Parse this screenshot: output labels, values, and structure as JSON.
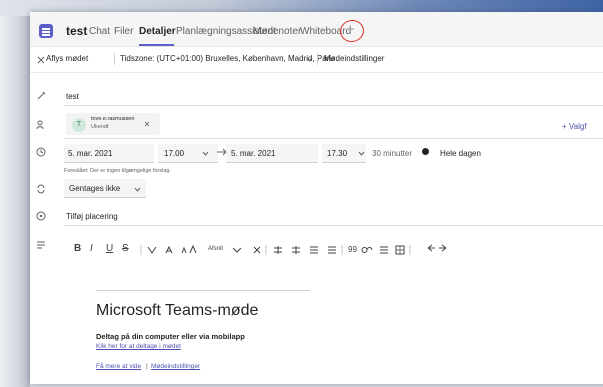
{
  "header": {
    "title": "test",
    "tabs": [
      "Chat",
      "Filer",
      "Detaljer",
      "Planlægningsassistent",
      "Mødenoter",
      "Whiteboard"
    ],
    "add_tab": "+"
  },
  "toolbar": {
    "cancel": "Aflys mødet",
    "timezone": "Tidszone: (UTC+01:00) Bruxelles, København, Madrid, Paris",
    "options": "Mødeindstillinger"
  },
  "form": {
    "title_value": "test",
    "attendee_initial": "T",
    "attendee_name": "tove.e.rasmussen",
    "attendee_status": "Ukendt",
    "optional_link": "+ Valgf",
    "start_date": "5. mar. 2021",
    "start_time": "17.00",
    "end_date": "5. mar. 2021",
    "end_time": "17.30",
    "duration": "30 minutter",
    "all_day": "Hele dagen",
    "suggestion": "Foreslået: Der er ingen tilgængelige forslag.",
    "repeat": "Gentages ikke",
    "location_placeholder": "Tilføj placering"
  },
  "formatting": {
    "bold": "B",
    "italic": "I",
    "underline": "U",
    "strike": "S",
    "paragraph": "Afsnit",
    "quote": "99"
  },
  "body": {
    "meeting_title": "Microsoft Teams-møde",
    "join_heading": "Deltag på din computer eller via mobilapp",
    "join_link": "Klik her for at deltage i mødet",
    "more_info": "Få mere at vide",
    "meeting_options": "Mødeindstillinger"
  },
  "colors": {
    "accent": "#5b5fc7",
    "annotation": "#e0312b"
  }
}
